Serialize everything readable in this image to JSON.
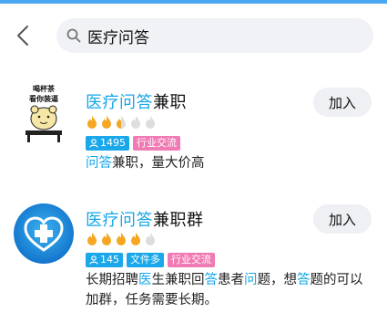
{
  "search": {
    "query": "医疗问答"
  },
  "results": [
    {
      "name_highlight": "医疗问答",
      "name_rest": "兼职",
      "avatar_text_1": "喝杯茶",
      "avatar_text_2": "看你装逼",
      "join_label": "加入",
      "flames": {
        "active": 2.5,
        "total": 5
      },
      "member_count": "1495",
      "tags": [
        "行业交流"
      ],
      "desc_hl_1": "问答",
      "desc_rest_1": "兼职，量大价高"
    },
    {
      "name_highlight": "医疗问答",
      "name_rest": "兼职群",
      "join_label": "加入",
      "flames": {
        "active": 4,
        "total": 5
      },
      "member_count": "145",
      "tags_blue": [
        "文件多"
      ],
      "tags": [
        "行业交流"
      ],
      "desc_1": "长期招聘",
      "desc_hl_1": "医",
      "desc_2": "生兼职回",
      "desc_hl_2": "答",
      "desc_3": "患者",
      "desc_hl_3": "问",
      "desc_4": "题，想",
      "desc_hl_4": "答",
      "desc_5": "题的可以",
      "desc_line2": "加群，任务需要长期。"
    }
  ],
  "colors": {
    "highlight": "#14a6e8",
    "flame_active": "#f5a623",
    "flame_inactive": "#dddddd",
    "count_badge": "#1aa8eb",
    "tag_badge": "#f07ab4"
  }
}
